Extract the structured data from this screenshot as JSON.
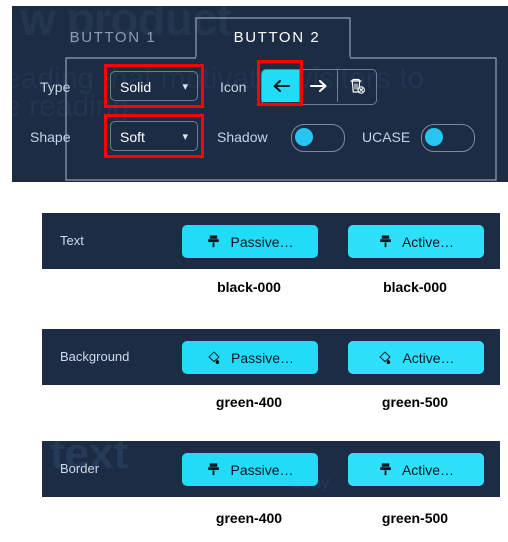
{
  "panel": {
    "watermarks": {
      "product": "w product",
      "line1": "eading that motivates visitors to",
      "line2": "e reading."
    },
    "tabs": [
      {
        "label": "BUTTON 1",
        "active": false
      },
      {
        "label": "BUTTON 2",
        "active": true
      }
    ],
    "fields": {
      "type_label": "Type",
      "type_value": "Solid",
      "shape_label": "Shape",
      "shape_value": "Soft",
      "icon_label": "Icon",
      "shadow_label": "Shadow",
      "ucase_label": "UCASE"
    },
    "icon_buttons": [
      {
        "name": "arrow-left-icon",
        "glyph": "←",
        "selected": true
      },
      {
        "name": "arrow-right-icon",
        "glyph": "→",
        "selected": false
      },
      {
        "name": "delete-trash-icon",
        "glyph": "🗑",
        "selected": false
      }
    ],
    "toggles": [
      {
        "name": "shadow",
        "on": false
      },
      {
        "name": "ucase",
        "on": false
      }
    ],
    "annotation_color": "#ff0000",
    "accent_color": "#22dcf7",
    "panel_bg": "#1c2c45"
  },
  "rows": [
    {
      "label": "Text",
      "watermark": "",
      "icon": "brush-icon",
      "passive": {
        "button_label": "Passive…",
        "caption": "black-000"
      },
      "active": {
        "button_label": "Active…",
        "caption": "black-000"
      }
    },
    {
      "label": "Background",
      "watermark": "",
      "icon": "paint-bucket-icon",
      "passive": {
        "button_label": "Passive…",
        "caption": "green-400"
      },
      "active": {
        "button_label": "Active…",
        "caption": "green-500"
      }
    },
    {
      "label": "Border",
      "watermark": "text",
      "icon": "brush-icon",
      "passive": {
        "button_label": "Passive…",
        "caption": "green-400"
      },
      "active": {
        "button_label": "Active…",
        "caption": "green-500"
      }
    }
  ],
  "row_extras": {
    "copy_label": "Copy"
  }
}
